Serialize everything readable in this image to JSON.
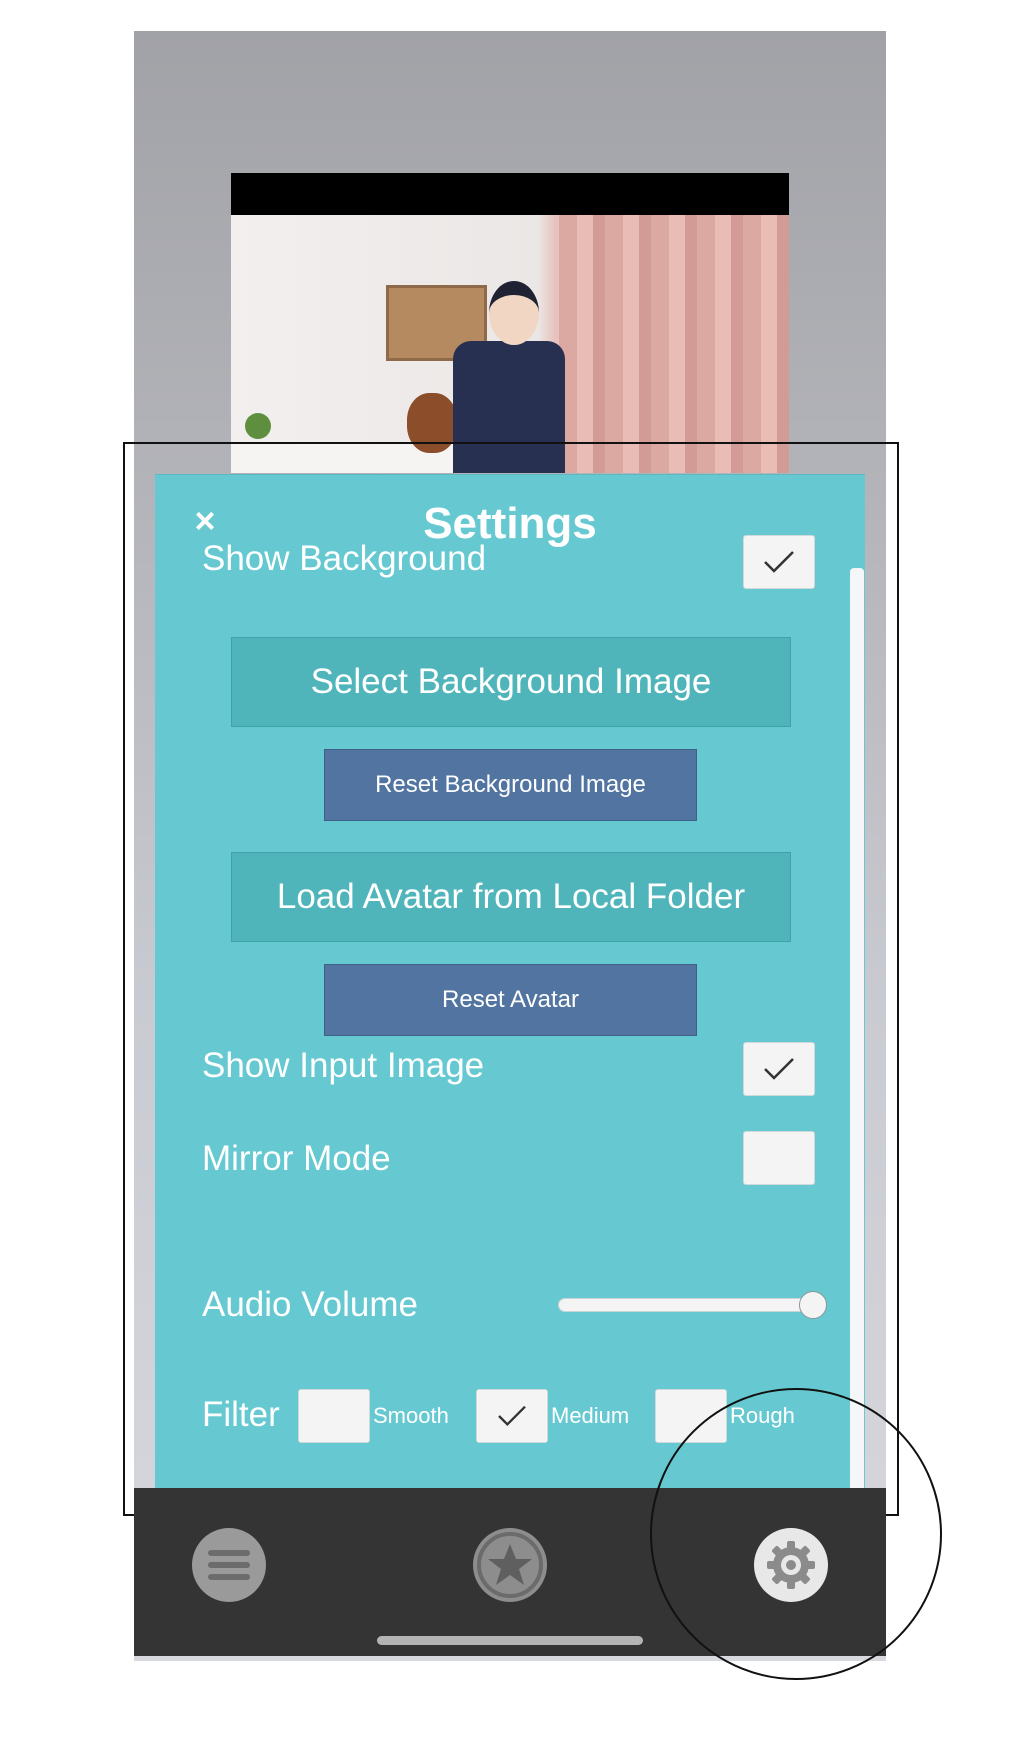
{
  "settings": {
    "title": "Settings",
    "close_icon": "×",
    "show_background": {
      "label": "Show Background",
      "checked": true
    },
    "select_background_button": "Select Background Image",
    "reset_background_button": "Reset Background Image",
    "load_avatar_button": "Load Avatar from Local Folder",
    "reset_avatar_button": "Reset Avatar",
    "show_input_image": {
      "label": "Show Input Image",
      "checked": true
    },
    "mirror_mode": {
      "label": "Mirror Mode",
      "checked": false
    },
    "audio_volume": {
      "label": "Audio Volume",
      "value": 1.0
    },
    "filter": {
      "label": "Filter",
      "options": [
        {
          "label": "Smooth",
          "checked": false
        },
        {
          "label": "Medium",
          "checked": true
        },
        {
          "label": "Rough",
          "checked": false
        }
      ]
    }
  },
  "navbar": {
    "items": [
      {
        "name": "menu-icon",
        "active": false
      },
      {
        "name": "star-icon",
        "active": false
      },
      {
        "name": "gear-icon",
        "active": true
      }
    ]
  },
  "colors": {
    "panel": "#66c9d1",
    "teal_button": "#4fb5bb",
    "blue_button": "#5174a1",
    "navbar": "#343434"
  }
}
